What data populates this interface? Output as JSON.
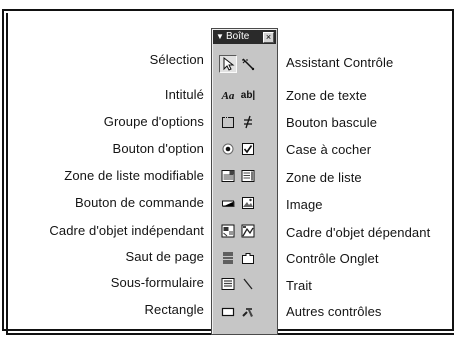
{
  "toolbox": {
    "title": "Boîte",
    "close_glyph": "×",
    "text_glyph": "Aa",
    "textbox_glyph": "ab|"
  },
  "left_labels": [
    "Sélection",
    "Intitulé",
    "Groupe d'options",
    "Bouton d'option",
    "Zone de liste modifiable",
    "Bouton de commande",
    "Cadre d'objet indépendant",
    "Saut de page",
    "Sous-formulaire",
    "Rectangle"
  ],
  "right_labels": [
    "Assistant Contrôle",
    "Zone de texte",
    "Bouton bascule",
    "Case à cocher",
    "Zone de liste",
    "Image",
    "Cadre d'objet dépendant",
    "Contrôle Onglet",
    "Trait",
    "Autres contrôles"
  ],
  "icons": [
    "select-objects-icon",
    "control-wizard-icon",
    "label-icon",
    "textbox-icon",
    "option-group-icon",
    "toggle-button-icon",
    "option-button-icon",
    "checkbox-icon",
    "combo-box-icon",
    "list-box-icon",
    "command-button-icon",
    "image-icon",
    "unbound-object-frame-icon",
    "bound-object-frame-icon",
    "page-break-icon",
    "tab-control-icon",
    "subform-icon",
    "line-icon",
    "rectangle-icon",
    "more-controls-icon"
  ]
}
